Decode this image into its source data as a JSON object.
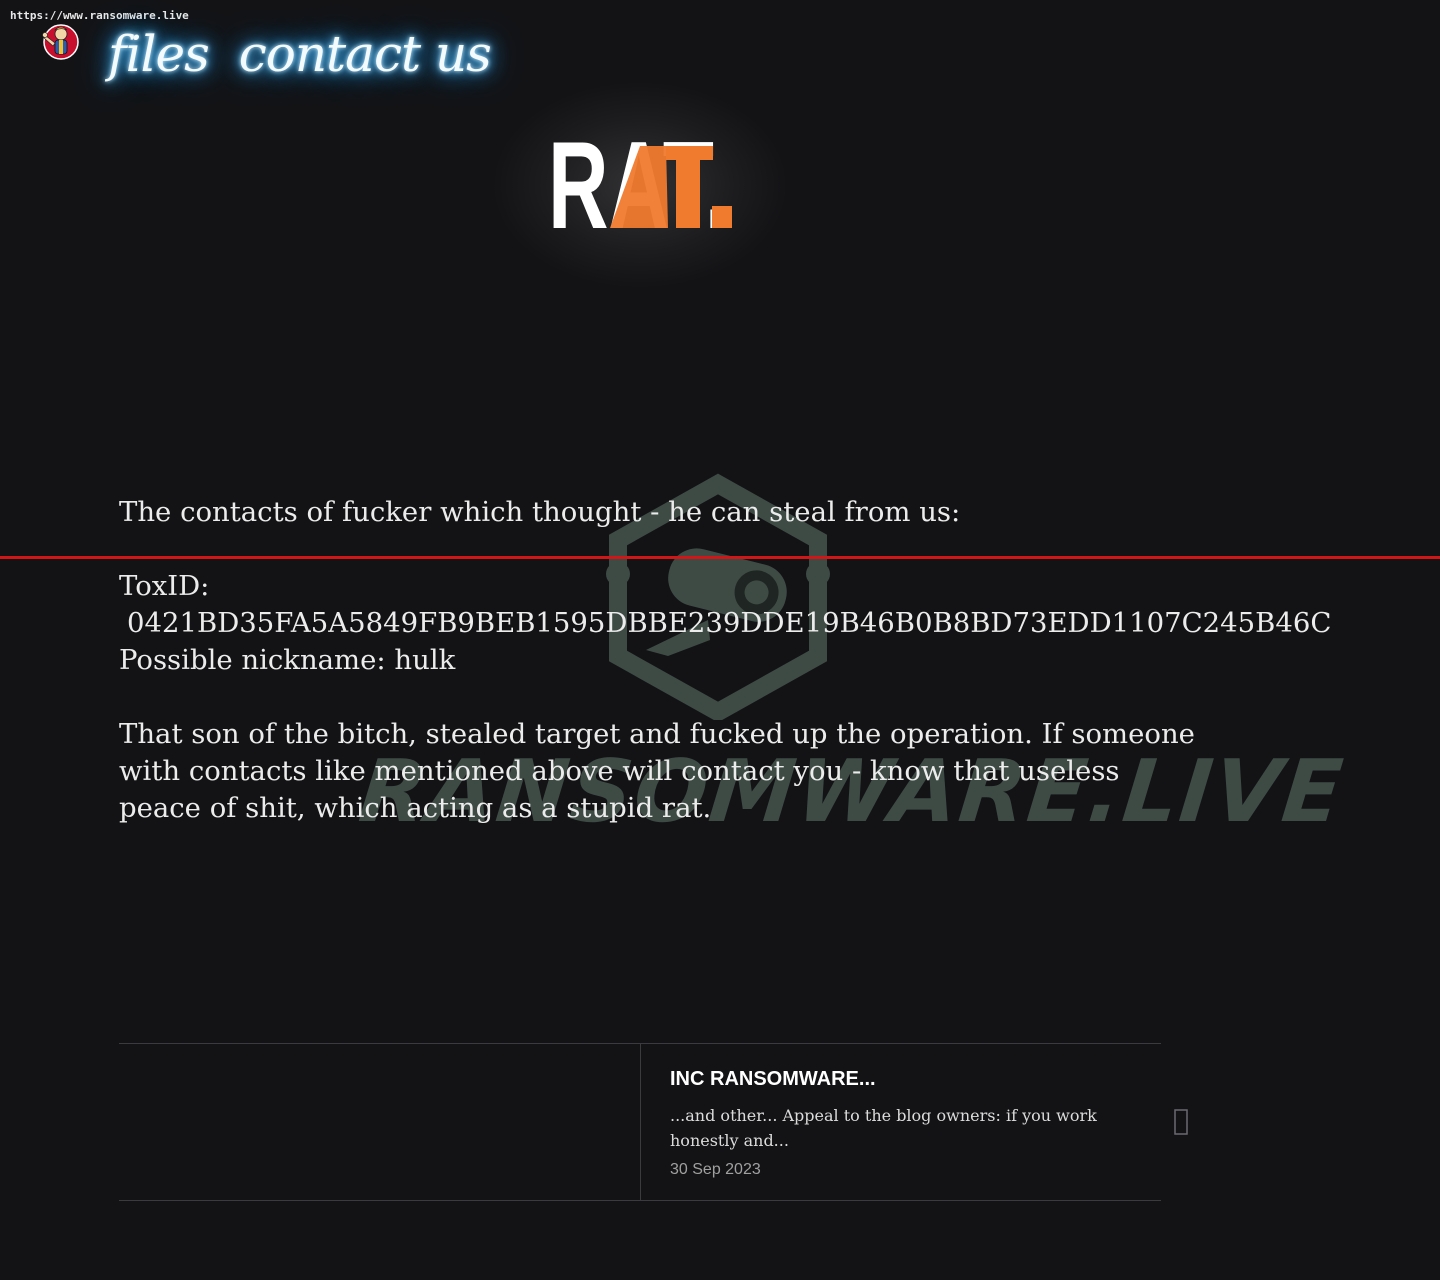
{
  "watermark_url": "https://www.ransomware.live",
  "nav": {
    "files": "files",
    "contact": "contact us"
  },
  "logo": {
    "text": "RAT.",
    "accent_color": "#f07a2d"
  },
  "watermark": {
    "text": "RANSOMWARE.LIVE"
  },
  "article": {
    "intro": "The contacts of fucker which thought - he can steal from us:",
    "toxid_label": "ToxID:",
    "toxid_value": "0421BD35FA5A5849FB9BEB1595DBBE239DDE19B46B0B8BD73EDD1107C245B46C",
    "nickname": "Possible nickname: hulk",
    "body": "That son of the bitch, stealed target and fucked up the operation. If someone with contacts like mentioned above will contact you - know that useless peace of shit, which acting as a stupid rat."
  },
  "related_post": {
    "title": "INC RANSOMWARE...",
    "excerpt": "...and other... Appeal to the blog owners: if you work honestly and...",
    "date": "30 Sep 2023"
  },
  "icons": {
    "mascot": "vault-boy-mascot-icon",
    "next": "chevron-right-icon"
  },
  "colors": {
    "background": "#131316",
    "nav_glow": "#2aa4ff",
    "divider_red": "#d01616",
    "watermark": "#3e4b45"
  }
}
